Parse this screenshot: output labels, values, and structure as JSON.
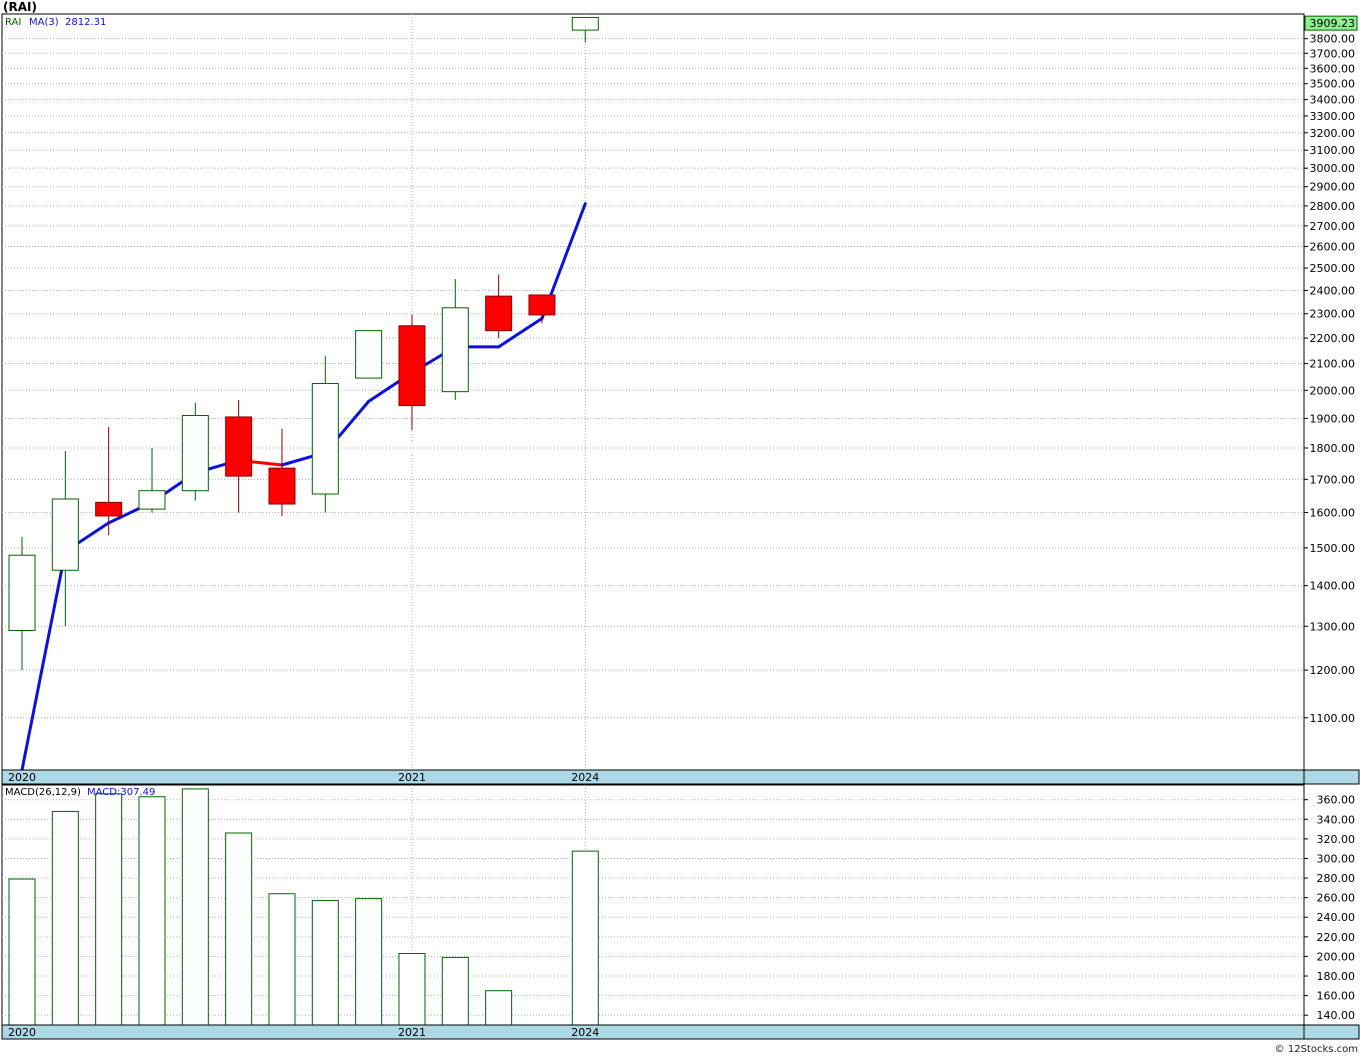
{
  "title": "(RAI)",
  "footer": "© 12Stocks.com",
  "colors": {
    "up": "#006400",
    "down": "#ff0000",
    "ma": "#1010dd",
    "grid": "#b4b4b4",
    "band": "#add8e6",
    "last_badge": "#90ee90"
  },
  "chart_data": [
    {
      "type": "candlestick",
      "scale": "log",
      "legend": {
        "symbol": "RAI",
        "ma_label": "MA(3)",
        "ma_value": "2812.31"
      },
      "ylim": [
        1000,
        3975
      ],
      "y_ticks": [
        "1100.00",
        "1200.00",
        "1300.00",
        "1400.00",
        "1500.00",
        "1600.00",
        "1700.00",
        "1800.00",
        "1900.00",
        "2000.00",
        "2100.00",
        "2200.00",
        "2300.00",
        "2400.00",
        "2500.00",
        "2600.00",
        "2700.00",
        "2800.00",
        "2900.00",
        "3000.00",
        "3100.00",
        "3200.00",
        "3300.00",
        "3400.00",
        "3500.00",
        "3600.00",
        "3700.00",
        "3800.00"
      ],
      "last_price_label": "3909.23",
      "x_labels": [
        {
          "text": "2020",
          "index": 0
        },
        {
          "text": "2021",
          "index": 9
        },
        {
          "text": "2024",
          "index": 13
        }
      ],
      "candles": [
        {
          "o": 1290,
          "h": 1530,
          "l": 1200,
          "c": 1480
        },
        {
          "o": 1440,
          "h": 1790,
          "l": 1300,
          "c": 1640
        },
        {
          "o": 1630,
          "h": 1870,
          "l": 1535,
          "c": 1590
        },
        {
          "o": 1610,
          "h": 1800,
          "l": 1600,
          "c": 1665
        },
        {
          "o": 1665,
          "h": 1955,
          "l": 1635,
          "c": 1910
        },
        {
          "o": 1905,
          "h": 1965,
          "l": 1600,
          "c": 1710
        },
        {
          "o": 1735,
          "h": 1865,
          "l": 1590,
          "c": 1625
        },
        {
          "o": 1655,
          "h": 2130,
          "l": 1600,
          "c": 2025
        },
        {
          "o": 2045,
          "h": 2230,
          "l": 2045,
          "c": 2230
        },
        {
          "o": 2250,
          "h": 2295,
          "l": 1860,
          "c": 1945
        },
        {
          "o": 1995,
          "h": 2450,
          "l": 1965,
          "c": 2325
        },
        {
          "o": 2375,
          "h": 2470,
          "l": 2200,
          "c": 2230
        },
        {
          "o": 2380,
          "h": 2380,
          "l": 2260,
          "c": 2295
        },
        {
          "o": 3860,
          "h": 3950,
          "l": 3775,
          "c": 3950
        }
      ],
      "ma": [
        {
          "index": 0,
          "value": 1000
        },
        {
          "index": 1,
          "value": 1490
        },
        {
          "index": 2,
          "value": 1570
        },
        {
          "index": 3,
          "value": 1630
        },
        {
          "index": 4,
          "value": 1720
        },
        {
          "index": 5,
          "value": 1760
        },
        {
          "index": 6,
          "value": 1745
        },
        {
          "index": 7,
          "value": 1785
        },
        {
          "index": 8,
          "value": 1960
        },
        {
          "index": 9,
          "value": 2065
        },
        {
          "index": 10,
          "value": 2165
        },
        {
          "index": 11,
          "value": 2165
        },
        {
          "index": 12,
          "value": 2280
        },
        {
          "index": 13,
          "value": 2812
        }
      ]
    },
    {
      "type": "bar",
      "legend": {
        "label": "MACD(26,12,9)",
        "value_label": "MACD:307.49"
      },
      "ylim": [
        130,
        375
      ],
      "y_ticks": [
        "140.00",
        "160.00",
        "180.00",
        "200.00",
        "220.00",
        "240.00",
        "260.00",
        "280.00",
        "300.00",
        "320.00",
        "340.00",
        "360.00"
      ],
      "x_labels": [
        {
          "text": "2020",
          "index": 0
        },
        {
          "text": "2021",
          "index": 9
        },
        {
          "text": "2024",
          "index": 13
        }
      ],
      "bars": [
        {
          "index": 0,
          "value": 279
        },
        {
          "index": 1,
          "value": 348
        },
        {
          "index": 2,
          "value": 366
        },
        {
          "index": 3,
          "value": 363
        },
        {
          "index": 4,
          "value": 371
        },
        {
          "index": 5,
          "value": 326
        },
        {
          "index": 6,
          "value": 264
        },
        {
          "index": 7,
          "value": 257
        },
        {
          "index": 8,
          "value": 259
        },
        {
          "index": 9,
          "value": 203
        },
        {
          "index": 10,
          "value": 199
        },
        {
          "index": 11,
          "value": 165
        },
        {
          "index": 13,
          "value": 307.49
        }
      ]
    }
  ]
}
